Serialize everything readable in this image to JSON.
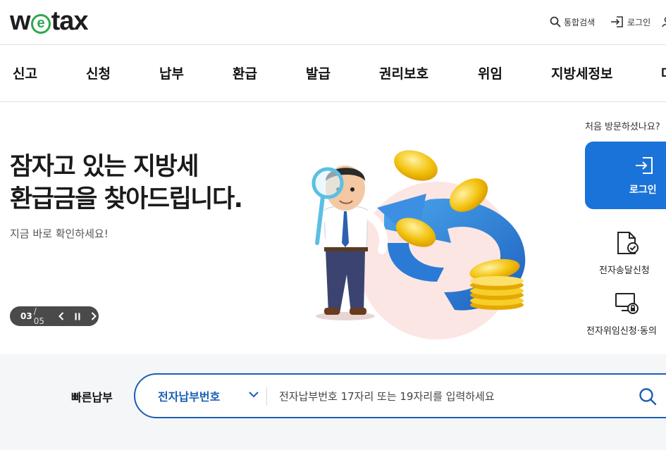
{
  "header": {
    "logo_pre": "w",
    "logo_e": "e",
    "logo_post": "tax",
    "search_label": "통합검색",
    "login_label": "로그인"
  },
  "gnb": [
    "신고",
    "신청",
    "납부",
    "환급",
    "발급",
    "권리보호",
    "위임",
    "지방세정보",
    "마"
  ],
  "hero": {
    "title_line1": "잠자고 있는 지방세",
    "title_line2": "환급금을 찾아드립니다.",
    "subtitle": "지금 바로 확인하세요!",
    "pager_current": "03",
    "pager_total": "/ 05"
  },
  "side": {
    "visit_question": "처음 방문하셨나요?",
    "login_card_label": "로그인",
    "service1": "전자송달신청",
    "service2": "전자위임신청·동의"
  },
  "quick_pay": {
    "label": "빠른납부",
    "select_value": "전자납부번호",
    "placeholder": "전자납부번호 17자리 또는 19자리를 입력하세요"
  },
  "colors": {
    "brand_blue": "#1a73d8",
    "accent_blue": "#1a5fb4",
    "logo_green": "#2fa84f"
  }
}
